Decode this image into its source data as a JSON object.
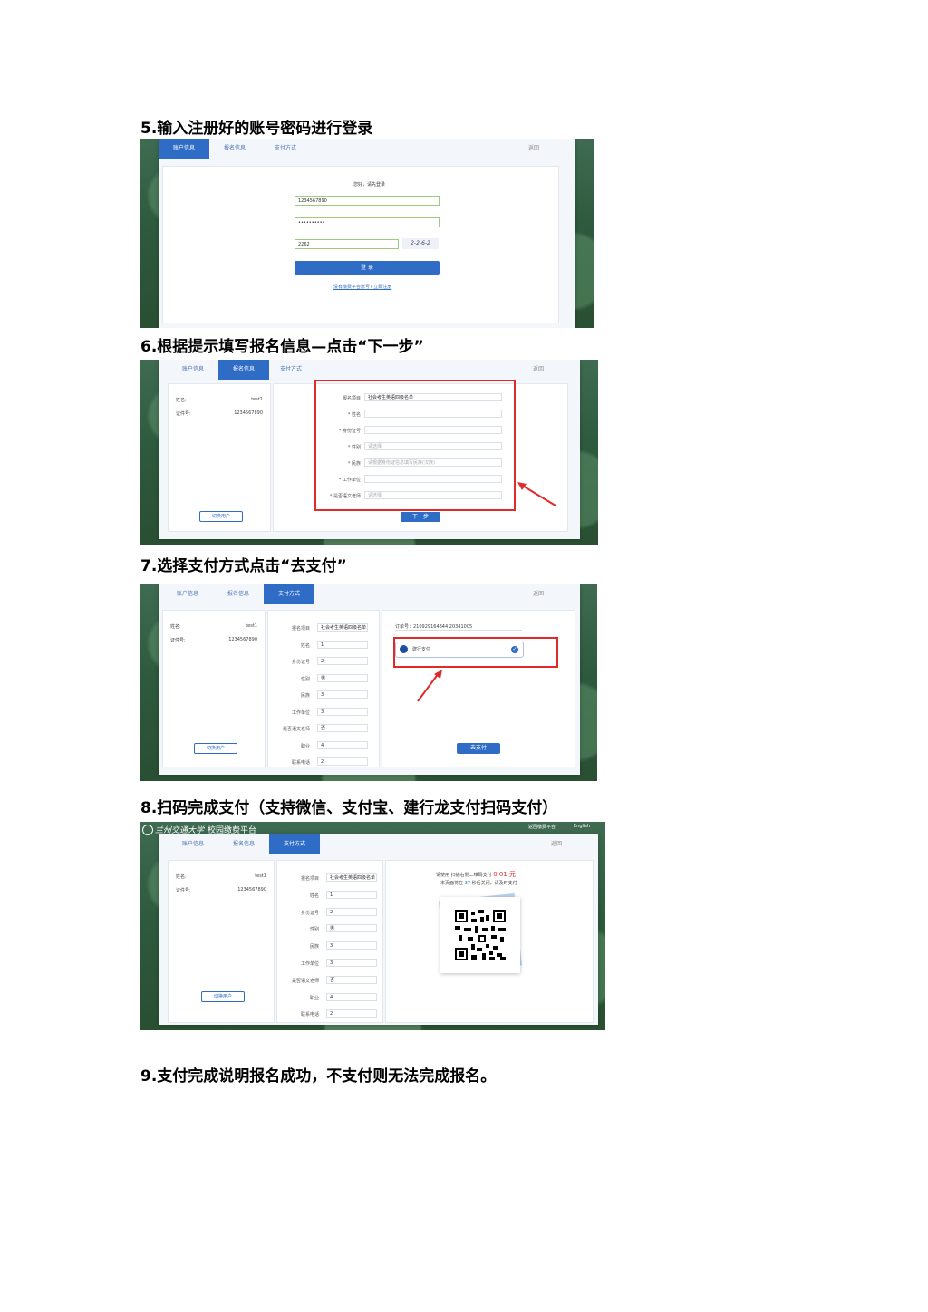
{
  "headings": {
    "step5": "5.输入注册好的账号密码进行登录",
    "step6": "6.根据提示填写报名信息—点击“下一步”",
    "step7": "7.选择支付方式点击“去支付”",
    "step8": "8.扫码完成支付（支持微信、支付宝、建行龙支付扫码支付）",
    "step9": "9.支付完成说明报名成功，不支付则无法完成报名。"
  },
  "tabs": {
    "account": "账户信息",
    "signup": "报名信息",
    "pay": "支付方式",
    "back": "返回"
  },
  "login": {
    "greeting": "您好，请先登录",
    "username": "1234567890",
    "password": "••••••••••",
    "captcha_input": "2262",
    "captcha_image": "2-2-6-2",
    "submit": "登 录",
    "register_link": "没有缴费平台账号? 立即注册"
  },
  "sidebar": {
    "name_label": "姓名:",
    "name_value": "test1",
    "id_label": "证件号:",
    "id_value": "1234567890",
    "switch_user": "切换用户"
  },
  "form6": {
    "rows": [
      {
        "label": "报名项目",
        "value": "社会考生英语四级名单"
      },
      {
        "label": "* 姓名",
        "value": ""
      },
      {
        "label": "* 身份证号",
        "value": ""
      },
      {
        "label": "* 性别",
        "value": "请选择"
      },
      {
        "label": "* 民族",
        "value": "请根据身份证信息填写民族(汉族)"
      },
      {
        "label": "* 工作单位",
        "value": ""
      },
      {
        "label": "* 是否语文老师",
        "value": "请选择"
      }
    ],
    "next": "下一步"
  },
  "form7": {
    "rows": [
      {
        "label": "报名项目",
        "value": "社会考生英语四级名单"
      },
      {
        "label": "姓名",
        "value": "1"
      },
      {
        "label": "身份证号",
        "value": "2"
      },
      {
        "label": "性别",
        "value": "男"
      },
      {
        "label": "民族",
        "value": "3"
      },
      {
        "label": "工作单位",
        "value": "3"
      },
      {
        "label": "是否语文老师",
        "value": "否"
      },
      {
        "label": "职业",
        "value": "4"
      },
      {
        "label": "联系电话",
        "value": "2"
      }
    ],
    "order": "订单号：210929164844 20341005",
    "method": "建行支付",
    "pay": "去支付"
  },
  "step8": {
    "univ": "兰州交通大学",
    "platform": "校园缴费平台",
    "return_platform": "返回缴费平台",
    "english": "English",
    "pay_prompt": "请使用  扫描右侧二维码支付",
    "amount": "0.01 元",
    "countdown_prefix": "本页面将在",
    "countdown_seconds": "37",
    "countdown_suffix": "秒后关闭，请及时支付"
  },
  "colors": {
    "accent": "#2f6cc6",
    "red": "#e02a2a",
    "green": "#2e5a3d"
  }
}
